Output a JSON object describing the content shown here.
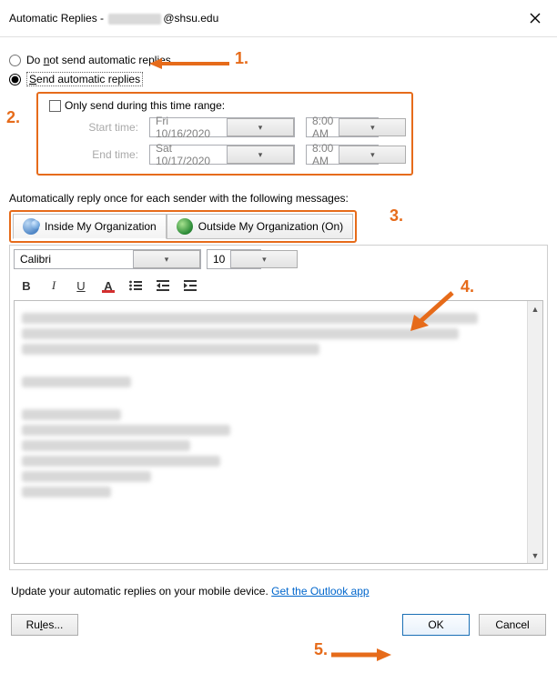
{
  "window": {
    "title_prefix": "Automatic Replies - ",
    "title_suffix": "@shsu.edu"
  },
  "radios": {
    "do_not_send_pre": "Do ",
    "do_not_send_ul": "n",
    "do_not_send_post": "ot send automatic replies",
    "send_pre": "",
    "send_ul": "S",
    "send_post": "end automatic replies"
  },
  "timerange": {
    "only_pre": "",
    "only_ul": "O",
    "only_post": "nly send during this time range:",
    "start_label": "Start time:",
    "end_label": "End time:",
    "start_date": "Fri 10/16/2020",
    "start_time": "8:00 AM",
    "end_date": "Sat 10/17/2020",
    "end_time": "8:00 AM"
  },
  "sub_caption": "Automatically reply once for each sender with the following messages:",
  "tabs": {
    "inside_pre": "",
    "inside_ul": "I",
    "inside_post": "nside My Organization",
    "outside_pre": "O",
    "outside_ul": "u",
    "outside_post": "tside My Organization (On)"
  },
  "editor": {
    "font": "Calibri",
    "size": "10"
  },
  "footer": {
    "text": "Update your automatic replies on your mobile device. ",
    "link": "Get the Outlook app"
  },
  "buttons": {
    "rules_pre": "Ru",
    "rules_ul": "l",
    "rules_post": "es...",
    "ok": "OK",
    "cancel": "Cancel"
  },
  "annotations": {
    "a1": "1.",
    "a2": "2.",
    "a3": "3.",
    "a4": "4.",
    "a5": "5."
  }
}
